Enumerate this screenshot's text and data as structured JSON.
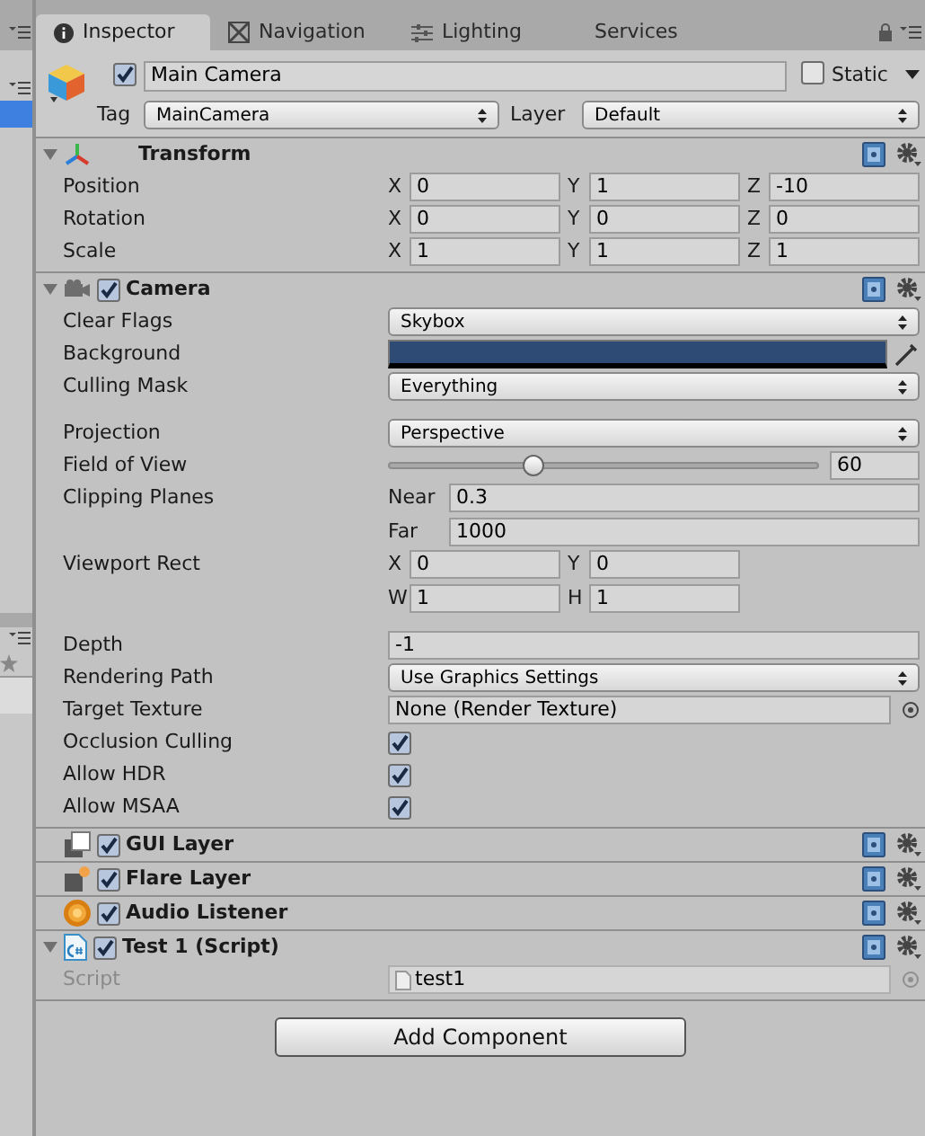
{
  "tabs": [
    {
      "label": "Inspector",
      "selected": true
    },
    {
      "label": "Navigation",
      "selected": false
    },
    {
      "label": "Lighting",
      "selected": false
    },
    {
      "label": "Services",
      "selected": false
    }
  ],
  "object": {
    "active": true,
    "name": "Main Camera",
    "static": false,
    "static_label": "Static",
    "tag_label": "Tag",
    "tag": "MainCamera",
    "layer_label": "Layer",
    "layer": "Default"
  },
  "components": [
    {
      "kind": "transform",
      "title": "Transform",
      "expanded": true,
      "rows": [
        {
          "kind": "vector",
          "label": "Position",
          "fields": [
            {
              "axis": "X",
              "value": "0"
            },
            {
              "axis": "Y",
              "value": "1"
            },
            {
              "axis": "Z",
              "value": "-10"
            }
          ]
        },
        {
          "kind": "vector",
          "label": "Rotation",
          "fields": [
            {
              "axis": "X",
              "value": "0"
            },
            {
              "axis": "Y",
              "value": "0"
            },
            {
              "axis": "Z",
              "value": "0"
            }
          ]
        },
        {
          "kind": "vector",
          "label": "Scale",
          "fields": [
            {
              "axis": "X",
              "value": "1"
            },
            {
              "axis": "Y",
              "value": "1"
            },
            {
              "axis": "Z",
              "value": "1"
            }
          ]
        }
      ]
    },
    {
      "kind": "camera",
      "title": "Camera",
      "enabled": true,
      "expanded": true,
      "rows": [
        {
          "kind": "dropdown",
          "label": "Clear Flags",
          "value": "Skybox"
        },
        {
          "kind": "color",
          "label": "Background",
          "color": "#2d4b74"
        },
        {
          "kind": "dropdown",
          "label": "Culling Mask",
          "value": "Everything"
        },
        {
          "kind": "space"
        },
        {
          "kind": "dropdown",
          "label": "Projection",
          "value": "Perspective"
        },
        {
          "kind": "slider",
          "label": "Field of View",
          "level": 0.33,
          "value": "60"
        },
        {
          "kind": "pairs",
          "label": "Clipping Planes",
          "fields": [
            {
              "axis": "Near",
              "value": "0.3"
            },
            {
              "axis": "Far",
              "value": "1000"
            }
          ]
        },
        {
          "kind": "rect",
          "label": "Viewport Rect",
          "fields": [
            {
              "axis": "X",
              "value": "0"
            },
            {
              "axis": "Y",
              "value": "0"
            },
            {
              "axis": "W",
              "value": "1"
            },
            {
              "axis": "H",
              "value": "1"
            }
          ]
        },
        {
          "kind": "space"
        },
        {
          "kind": "text",
          "label": "Depth",
          "value": "-1"
        },
        {
          "kind": "dropdown",
          "label": "Rendering Path",
          "value": "Use Graphics Settings"
        },
        {
          "kind": "object",
          "label": "Target Texture",
          "value": "None (Render Texture)",
          "disabled": false
        },
        {
          "kind": "checkbox",
          "label": "Occlusion Culling",
          "checked": true
        },
        {
          "kind": "checkbox",
          "label": "Allow HDR",
          "checked": true
        },
        {
          "kind": "checkbox",
          "label": "Allow MSAA",
          "checked": true
        }
      ]
    },
    {
      "kind": "gui_layer",
      "title": "GUI Layer",
      "enabled": true
    },
    {
      "kind": "flare_layer",
      "title": "Flare Layer",
      "enabled": true
    },
    {
      "kind": "audio_listener",
      "title": "Audio Listener",
      "enabled": true
    },
    {
      "kind": "script",
      "title": "Test 1 (Script)",
      "enabled": true,
      "expanded": true,
      "rows": [
        {
          "kind": "object",
          "label": "Script",
          "value": "test1",
          "disabled": true
        }
      ]
    }
  ],
  "add_button": "Add Component"
}
